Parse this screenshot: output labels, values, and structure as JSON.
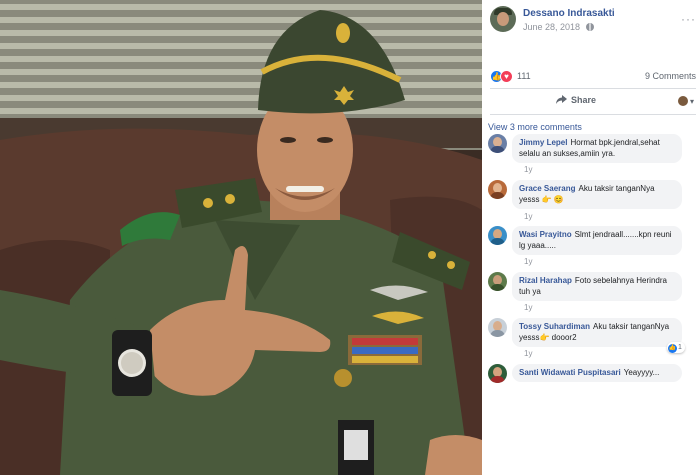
{
  "post": {
    "author": "Dessano Indrasakti",
    "date": "June 28, 2018",
    "more_icon": "more-icon",
    "privacy_icon": "globe-icon"
  },
  "reactions": {
    "count": "111",
    "comments": "9 Comments",
    "like_icon": "like-icon",
    "love_icon": "love-icon"
  },
  "actions": {
    "share_label": "Share",
    "share_icon": "share-icon"
  },
  "view_more": "View 3 more comments",
  "comments": [
    {
      "name": "Jimmy Lepel",
      "text": "Hormat bpk.jendral,sehat selalu an sukses,amiin yra.",
      "time": "1y",
      "avatar_color": "#6a7fa6",
      "skin": "#d9b092"
    },
    {
      "name": "Grace Saerang",
      "text": "Aku taksir tanganNya yesss 👉 😊",
      "time": "1y",
      "avatar_color": "#b86a3a",
      "skin": "#e2b48f"
    },
    {
      "name": "Wasi Prayitno",
      "text": "Slmt jendraall.......kpn reuni lg yaaa.....",
      "time": "1y",
      "avatar_color": "#3a8fc8",
      "skin": "#d6a882"
    },
    {
      "name": "Rizal Harahap",
      "text": "Foto sebelahnya Herindra tuh ya",
      "time": "1y",
      "avatar_color": "#5d7a4a",
      "skin": "#c99d7a"
    },
    {
      "name": "Tossy Suhardiman",
      "text": "Aku taksir tanganNya yesss👉  dooor2",
      "time": "1y",
      "avatar_color": "#c8d0d8",
      "skin": "#d8ad8c",
      "reaction_count": "1"
    },
    {
      "name": "Santi Widawati Puspitasari",
      "text": "Yeayyyy...",
      "time": "",
      "avatar_color": "#2e5d3a",
      "skin": "#d4a27e"
    }
  ]
}
